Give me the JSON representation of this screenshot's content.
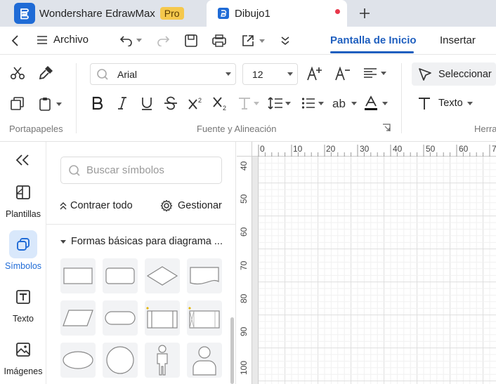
{
  "titlebar": {
    "app_name": "Wondershare EdrawMax",
    "pro_badge": "Pro",
    "doc_tab": "Dibujo1",
    "new_tab": "+"
  },
  "menu": {
    "archivo": "Archivo",
    "tabs": [
      "Pantalla de Inicio",
      "Insertar"
    ]
  },
  "ribbon": {
    "font_name": "Arial",
    "font_size": "12",
    "select_label": "Seleccionar",
    "text_label": "Texto",
    "groups": [
      "Portapapeles",
      "Fuente y Alineación",
      "Herra"
    ]
  },
  "rail": {
    "items": [
      {
        "label": "Plantillas",
        "icon": "templates-icon"
      },
      {
        "label": "Símbolos",
        "icon": "symbols-icon"
      },
      {
        "label": "Texto",
        "icon": "text-icon"
      },
      {
        "label": "Imágenes",
        "icon": "images-icon"
      }
    ]
  },
  "panel": {
    "search_placeholder": "Buscar símbolos",
    "collapse_all": "Contraer todo",
    "manage": "Gestionar",
    "category": "Formas básicas para diagrama ..."
  },
  "ruler": {
    "h": [
      "0",
      "10",
      "20",
      "30",
      "40",
      "50",
      "60",
      "7"
    ],
    "v": [
      "40",
      "50",
      "60",
      "70",
      "80",
      "90",
      "100"
    ]
  },
  "colors": {
    "accent": "#1f5fbf",
    "brand": "#1f6bd6",
    "pro": "#f5c84c",
    "unsaved": "#e8374a"
  }
}
